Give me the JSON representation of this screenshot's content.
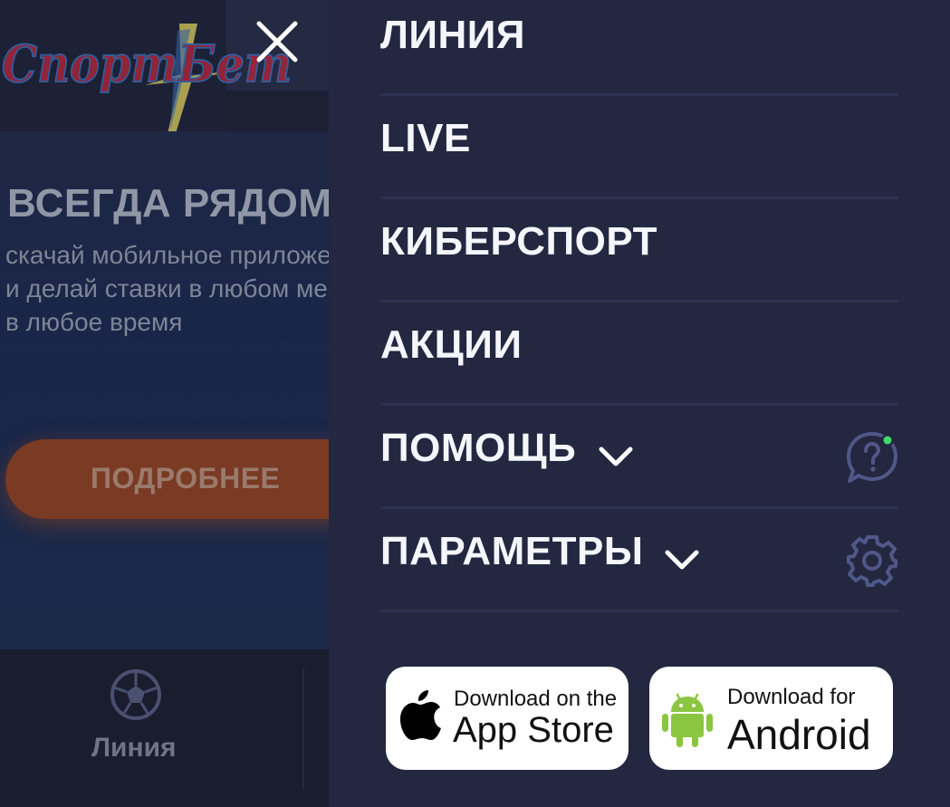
{
  "background": {
    "promo": {
      "title": "ВСЕГДА РЯДОМ",
      "lines": [
        "скачай мобильное приложение",
        "и делай ставки в любом месте",
        "в любое время"
      ],
      "button_label": "ПОДРОБНЕЕ"
    },
    "bottom_nav": {
      "line_label": "Линия"
    }
  },
  "menu": {
    "items": [
      {
        "label": "ЛИНИЯ"
      },
      {
        "label": "LIVE"
      },
      {
        "label": "КИБЕРСПОРТ"
      },
      {
        "label": "АКЦИИ"
      },
      {
        "label": "ПОМОЩЬ"
      },
      {
        "label": "ПАРАМЕТРЫ"
      }
    ],
    "appstore": {
      "small": "Download on the",
      "big": "App Store"
    },
    "android": {
      "small": "Download for",
      "big": "Android"
    }
  },
  "colors": {
    "menu_bg": "#232740",
    "separator": "#2c3250",
    "menu_text": "#f4f6fb",
    "icon_muted": "#5b6494",
    "status_dot": "#3ddc6a",
    "android_green": "#8ac640",
    "logo_red": "#c8283a"
  }
}
